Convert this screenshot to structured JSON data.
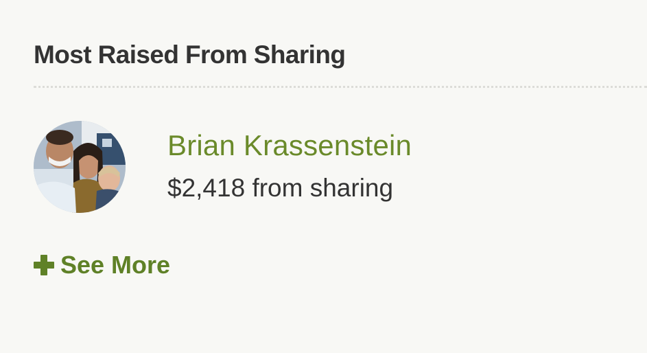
{
  "section": {
    "title": "Most Raised From Sharing"
  },
  "top_sharers": [
    {
      "name": "Brian Krassenstein",
      "amount": "$2,418",
      "suffix": "from sharing",
      "avatar": "family-photo-avatar"
    }
  ],
  "see_more": {
    "icon": "plus-icon",
    "label": "See More"
  },
  "colors": {
    "background": "#f8f8f5",
    "heading_text": "#333333",
    "accent_green": "#5f8127",
    "name_green": "#6a8a2a",
    "divider": "#dcdcd8"
  }
}
